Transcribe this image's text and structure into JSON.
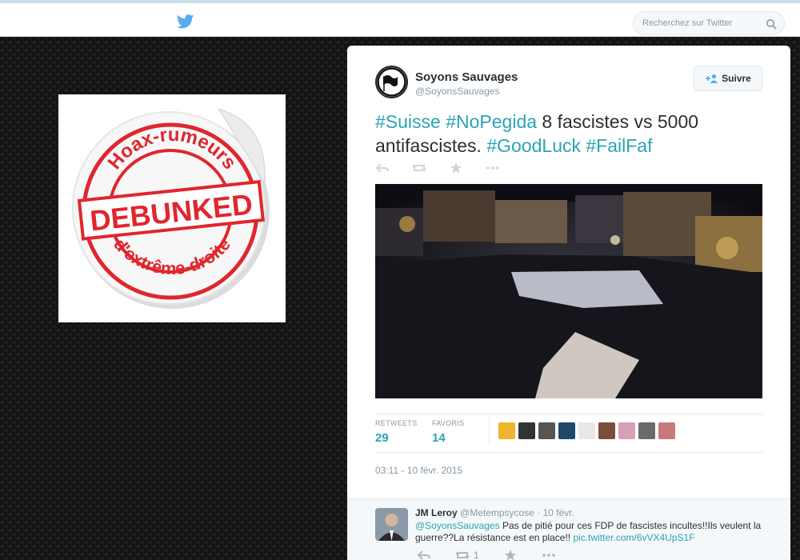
{
  "search": {
    "placeholder": "Recherchez sur Twitter"
  },
  "sticker": {
    "top_text": "Hoax-rumeurs",
    "center_text": "DEBUNKED",
    "bottom_text": "d'extrême-droite",
    "stamp_color": "#e0262d"
  },
  "tweet": {
    "author_name": "Soyons Sauvages",
    "author_handle": "@SoyonsSauvages",
    "follow_label": "Suivre",
    "text_parts": {
      "tag1": "#Suisse",
      "tag2": "#NoPegida",
      "plain1": "8 fascistes vs 5000 antifascistes.",
      "tag3": "#GoodLuck",
      "tag4": "#FailFaf"
    },
    "stats": {
      "retweets_label": "RETWEETS",
      "retweets_value": "29",
      "favorites_label": "FAVORIS",
      "favorites_value": "14"
    },
    "timestamp": "03:11 - 10 févr. 2015",
    "accent_color": "#2ba3b5"
  },
  "reply": {
    "name": "JM Leroy",
    "handle": "@Metempsycose",
    "time": "· 10 févr.",
    "mention": "@SoyonsSauvages",
    "text": "Pas de pitié pour ces FDP de fascistes incultes!!Ils veulent la guerre??La résistance est en place!!",
    "link": "pic.twitter.com/6vVX4UpS1F",
    "retweet_count": "1"
  }
}
